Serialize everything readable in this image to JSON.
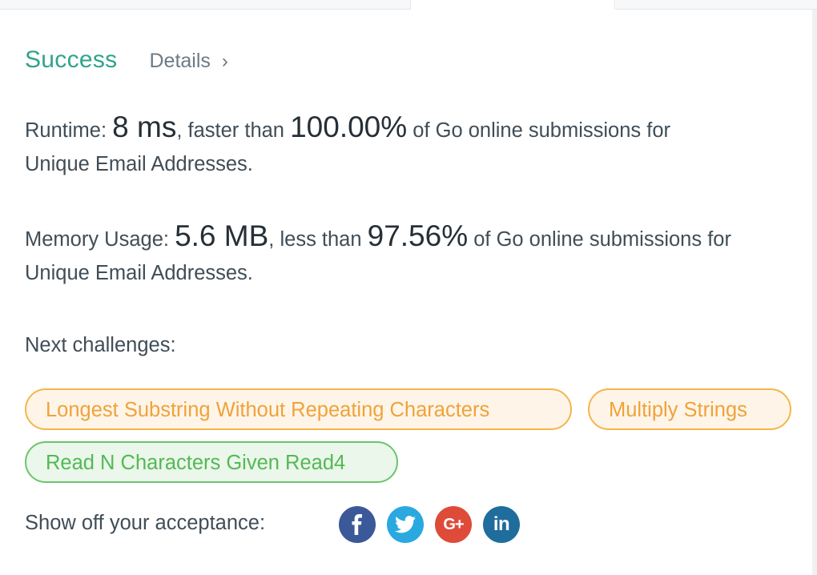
{
  "result": {
    "status": "Success",
    "details_label": "Details",
    "details_chevron": "›"
  },
  "runtime": {
    "label": "Runtime:",
    "value": "8 ms",
    "comparison": ", faster than",
    "percent": "100.00%",
    "suffix": "of Go online submissions for",
    "problem": "Unique Email Addresses."
  },
  "memory": {
    "label": "Memory Usage:",
    "value": "5.6 MB",
    "comparison": ", less than",
    "percent": "97.56%",
    "suffix": "of Go online submissions for",
    "problem": "Unique Email Addresses."
  },
  "next": {
    "label": "Next challenges:",
    "challenges": [
      {
        "title": "Longest Substring Without Repeating Characters",
        "difficulty_color": "#f0a23a"
      },
      {
        "title": "Multiply Strings",
        "difficulty_color": "#f0a23a"
      },
      {
        "title": "Read N Characters Given Read4",
        "difficulty_color": "#55b856"
      }
    ]
  },
  "share": {
    "label": "Show off your acceptance:",
    "networks": [
      {
        "icon": "facebook-icon",
        "glyph": "f",
        "color": "#3b5998"
      },
      {
        "icon": "twitter-icon",
        "glyph": "",
        "color": "#2aa8e0"
      },
      {
        "icon": "google-plus-icon",
        "glyph": "G+",
        "color": "#de4b39"
      },
      {
        "icon": "linkedin-icon",
        "glyph": "in",
        "color": "#1f6d9c"
      }
    ]
  },
  "colors": {
    "success": "#2fa48b",
    "text": "#404d57",
    "medium": "#f0a23a",
    "easy": "#55b856"
  }
}
